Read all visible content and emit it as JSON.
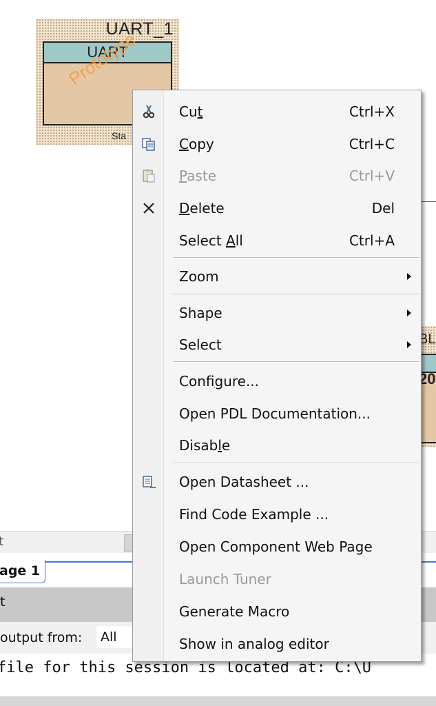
{
  "canvas": {
    "uart": {
      "instance_name": "UART_1",
      "type_label": "UART",
      "watermark": "Prototype",
      "footer_text": "Sta"
    },
    "right_component": {
      "instance_name": "BL",
      "value_text": "20"
    }
  },
  "dock": {
    "scroll_label": "t",
    "page_tab": "age 1",
    "output_header": "t",
    "filter_label": "output from:",
    "filter_value": "All",
    "output_line": "file for this session is located at: C:\\U"
  },
  "context_menu": {
    "items": [
      {
        "pre": "Cu",
        "key": "t",
        "post": "",
        "shortcut": "Ctrl+X",
        "icon": "scissors-icon",
        "disabled": false,
        "submenu": false
      },
      {
        "pre": "",
        "key": "C",
        "post": "opy",
        "shortcut": "Ctrl+C",
        "icon": "copy-icon",
        "disabled": false,
        "submenu": false
      },
      {
        "pre": "",
        "key": "P",
        "post": "aste",
        "shortcut": "Ctrl+V",
        "icon": "paste-icon",
        "disabled": true,
        "submenu": false
      },
      {
        "pre": "",
        "key": "D",
        "post": "elete",
        "shortcut": "Del",
        "icon": "delete-x-icon",
        "disabled": false,
        "submenu": false
      },
      {
        "pre": "Select ",
        "key": "A",
        "post": "ll",
        "shortcut": "Ctrl+A",
        "icon": "",
        "disabled": false,
        "submenu": false
      },
      {
        "pre": "Zoom",
        "key": "",
        "post": "",
        "shortcut": "",
        "icon": "",
        "disabled": false,
        "submenu": true
      },
      {
        "pre": "Shape",
        "key": "",
        "post": "",
        "shortcut": "",
        "icon": "",
        "disabled": false,
        "submenu": true
      },
      {
        "pre": "Select",
        "key": "",
        "post": "",
        "shortcut": "",
        "icon": "",
        "disabled": false,
        "submenu": true
      },
      {
        "pre": "Confi",
        "key": "g",
        "post": "ure...",
        "shortcut": "",
        "icon": "",
        "disabled": false,
        "submenu": false
      },
      {
        "pre": "Open PDL Documentation...",
        "key": "",
        "post": "",
        "shortcut": "",
        "icon": "",
        "disabled": false,
        "submenu": false
      },
      {
        "pre": "Disab",
        "key": "l",
        "post": "e",
        "shortcut": "",
        "icon": "",
        "disabled": false,
        "submenu": false
      },
      {
        "pre": "Open Datasheet ...",
        "key": "",
        "post": "",
        "shortcut": "",
        "icon": "datasheet-icon",
        "disabled": false,
        "submenu": false
      },
      {
        "pre": "Find Code Example ...",
        "key": "",
        "post": "",
        "shortcut": "",
        "icon": "",
        "disabled": false,
        "submenu": false
      },
      {
        "pre": "Open Component Web Page",
        "key": "",
        "post": "",
        "shortcut": "",
        "icon": "",
        "disabled": false,
        "submenu": false
      },
      {
        "pre": "Launch Tuner",
        "key": "",
        "post": "",
        "shortcut": "",
        "icon": "",
        "disabled": true,
        "submenu": false
      },
      {
        "pre": "Generate Macro",
        "key": "",
        "post": "",
        "shortcut": "",
        "icon": "",
        "disabled": false,
        "submenu": false
      },
      {
        "pre": "Show in analog editor",
        "key": "",
        "post": "",
        "shortcut": "",
        "icon": "",
        "disabled": false,
        "submenu": false
      }
    ]
  }
}
